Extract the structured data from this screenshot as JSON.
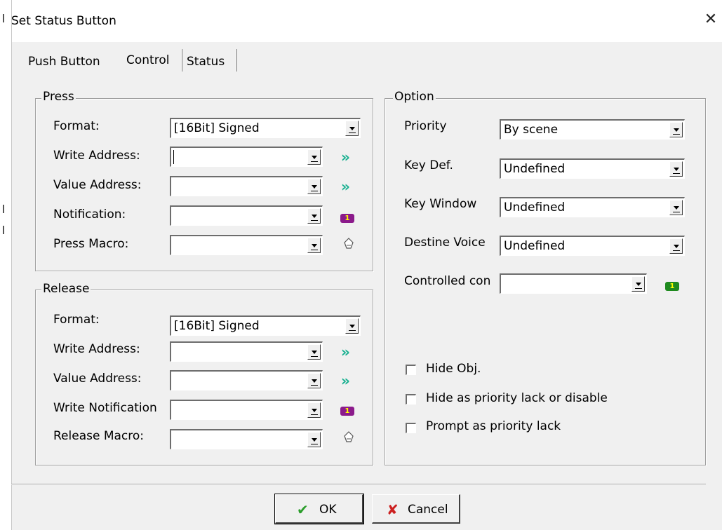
{
  "window": {
    "title": "Set Status Button",
    "close_icon": "close-icon"
  },
  "tabs": [
    {
      "label": "Push Button",
      "active": false
    },
    {
      "label": "Control",
      "active": true
    },
    {
      "label": "Status",
      "active": false
    }
  ],
  "press": {
    "label": "Press",
    "format_label": "Format:",
    "format_value": "[16Bit] Signed",
    "write_address_label": "Write Address:",
    "write_address_value": "",
    "value_address_label": "Value Address:",
    "value_address_value": "",
    "notification_label": "Notification:",
    "notification_value": "",
    "macro_label": "Press Macro:",
    "macro_value": ""
  },
  "release": {
    "label": "Release",
    "format_label": "Format:",
    "format_value": "[16Bit] Signed",
    "write_address_label": "Write Address:",
    "write_address_value": "",
    "value_address_label": "Value Address:",
    "value_address_value": "",
    "notification_label": "Write Notification",
    "notification_value": "",
    "macro_label": "Release Macro:",
    "macro_value": ""
  },
  "option": {
    "label": "Option",
    "priority_label": "Priority",
    "priority_value": "By scene",
    "keydef_label": "Key Def.",
    "keydef_value": "Undefined",
    "keywindow_label": "Key Window",
    "keywindow_value": "Undefined",
    "voice_label": "Destine Voice",
    "voice_value": "Undefined",
    "controlled_label": "Controlled con",
    "controlled_value": "",
    "hide_obj_label": "Hide Obj.",
    "hide_obj_checked": false,
    "hide_priority_label": "Hide as priority lack or disable",
    "hide_priority_checked": false,
    "prompt_label": "Prompt as priority lack",
    "prompt_checked": false
  },
  "icons": {
    "arrow_glyph": "»",
    "notify_badge_text": "1"
  },
  "colors": {
    "arrow": "#18b090",
    "notify_purple": "#8b1a8b",
    "notify_green": "#1f8a1f",
    "ok_check": "#2a9d2a",
    "cancel_x": "#cc2020"
  },
  "buttons": {
    "ok_label": "OK",
    "cancel_label": "Cancel",
    "ok_icon": "✔",
    "cancel_icon": "✘"
  }
}
